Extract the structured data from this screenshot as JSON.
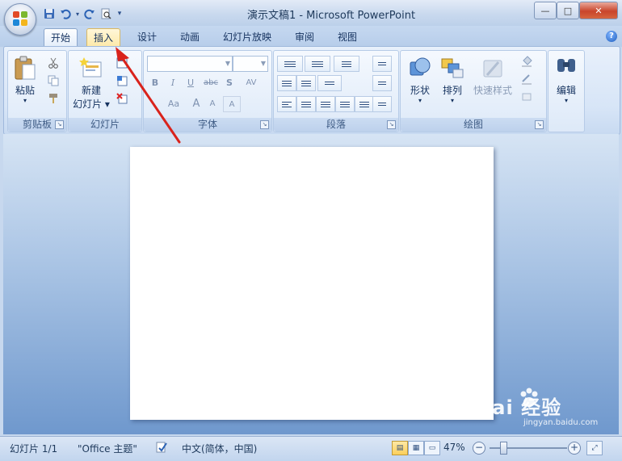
{
  "window": {
    "title": "演示文稿1 - Microsoft PowerPoint",
    "min_symbol": "—",
    "max_symbol": "□",
    "close_symbol": "✕"
  },
  "qat": {
    "more_symbol": "▾"
  },
  "tabs": [
    {
      "label": "开始",
      "state": "active"
    },
    {
      "label": "插入",
      "state": "hover"
    },
    {
      "label": "设计"
    },
    {
      "label": "动画"
    },
    {
      "label": "幻灯片放映"
    },
    {
      "label": "审阅"
    },
    {
      "label": "视图"
    }
  ],
  "help_symbol": "?",
  "ribbon": {
    "clipboard": {
      "label": "剪贴板",
      "paste": "粘贴",
      "paste_arrow": "▾"
    },
    "slides": {
      "label": "幻灯片",
      "new_slide_line1": "新建",
      "new_slide_line2": "幻灯片 ▾"
    },
    "font": {
      "label": "字体",
      "bold": "B",
      "italic": "I",
      "underline": "U",
      "strike": "abc",
      "shadow": "S",
      "spacing": "AV",
      "change_case": "Aa",
      "grow": "A",
      "shrink": "A",
      "clear": "A"
    },
    "paragraph": {
      "label": "段落"
    },
    "drawing": {
      "label": "绘图",
      "shapes": "形状",
      "arrange": "排列",
      "quick_styles": "快速样式"
    },
    "editing": {
      "label": "编辑"
    }
  },
  "status": {
    "slide_count": "幻灯片 1/1",
    "theme": "\"Office 主题\"",
    "language": "中文(简体，中国)",
    "zoom": "47%",
    "zoom_out": "−",
    "zoom_in": "+"
  },
  "watermark": {
    "main": "Bai  经验",
    "sub": "jingyan.baidu.com"
  },
  "colors": {
    "accent_arrow": "#d9231c",
    "ribbon": "#d7e5f7",
    "slide": "#ffffff"
  }
}
